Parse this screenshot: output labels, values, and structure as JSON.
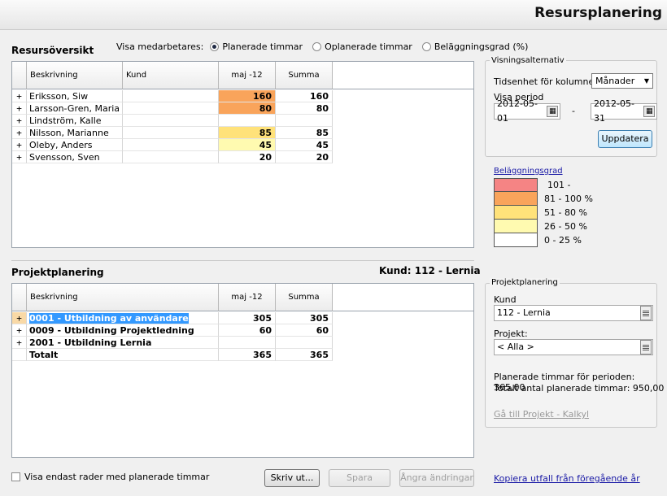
{
  "app": {
    "title": "Resursplanering"
  },
  "overview": {
    "title": "Resursöversikt",
    "show_label": "Visa medarbetares:",
    "radios": [
      {
        "label": "Planerade timmar",
        "checked": true
      },
      {
        "label": "Oplanerade timmar",
        "checked": false
      },
      {
        "label": "Beläggningsgrad (%)",
        "checked": false
      }
    ],
    "columns": [
      "Beskrivning",
      "Kund",
      "maj -12",
      "Summa"
    ],
    "rows": [
      {
        "expand": "+",
        "name": "Eriksson, Siw",
        "kund": "",
        "month": "160",
        "sum": "160",
        "color": "#f9a45b"
      },
      {
        "expand": "+",
        "name": "Larsson-Gren, Maria",
        "kund": "",
        "month": "80",
        "sum": "80",
        "color": "#f9a45b"
      },
      {
        "expand": "+",
        "name": "Lindström, Kalle",
        "kund": "",
        "month": "",
        "sum": "",
        "color": "#ffffff"
      },
      {
        "expand": "+",
        "name": "Nilsson, Marianne",
        "kund": "",
        "month": "85",
        "sum": "85",
        "color": "#ffe27a"
      },
      {
        "expand": "+",
        "name": "Oleby, Anders",
        "kund": "",
        "month": "45",
        "sum": "45",
        "color": "#fffab0"
      },
      {
        "expand": "+",
        "name": "Svensson, Sven",
        "kund": "",
        "month": "20",
        "sum": "20",
        "color": "#ffffff"
      }
    ]
  },
  "project": {
    "title": "Projektplanering",
    "customer_label": "Kund: 112 - Lernia",
    "columns": [
      "Beskrivning",
      "maj -12",
      "Summa"
    ],
    "rows": [
      {
        "expand": "+",
        "name": "0001 - Utbildning av användare",
        "month": "305",
        "sum": "305",
        "selected": true
      },
      {
        "expand": "+",
        "name": "0009 - Utbildning Projektledning",
        "month": "60",
        "sum": "60",
        "selected": false
      },
      {
        "expand": "+",
        "name": "2001 - Utbildning Lernia",
        "month": "",
        "sum": "",
        "selected": false
      },
      {
        "expand": "",
        "name": "Totalt",
        "month": "365",
        "sum": "365",
        "selected": false
      }
    ]
  },
  "view_options": {
    "title": "Visningsalternativ",
    "unit_label": "Tidsenhet för kolumner:",
    "unit_value": "Månader",
    "period_label": "Visa period",
    "date_from": "2012-05-01",
    "dash": "-",
    "date_to": "2012-05-31",
    "update_button": "Uppdatera"
  },
  "legend": {
    "title": "Beläggningsgrad",
    "items": [
      {
        "color": "#f58484",
        "label": "101 -"
      },
      {
        "color": "#f9a45b",
        "label": "81 - 100 %"
      },
      {
        "color": "#ffe27a",
        "label": "51 - 80 %"
      },
      {
        "color": "#fffab0",
        "label": "26 - 50 %"
      },
      {
        "color": "#ffffff",
        "label": "0 - 25 %"
      }
    ]
  },
  "project_panel": {
    "title": "Projektplanering",
    "kund_label": "Kund",
    "kund_value": "112 - Lernia",
    "projekt_label": "Projekt:",
    "projekt_value": "< Alla >",
    "planned_period": "Planerade timmar för perioden: 365,00",
    "planned_total": "Totalt antal planerade timmar: 950,00",
    "goto_link": "Gå till Projekt - Kalkyl"
  },
  "footer": {
    "checkbox_label": "Visa endast rader med planerade timmar",
    "print_button": "Skriv ut...",
    "save_button": "Spara",
    "undo_button": "Ångra ändringar",
    "copy_link": "Kopiera utfall från föregående år"
  }
}
